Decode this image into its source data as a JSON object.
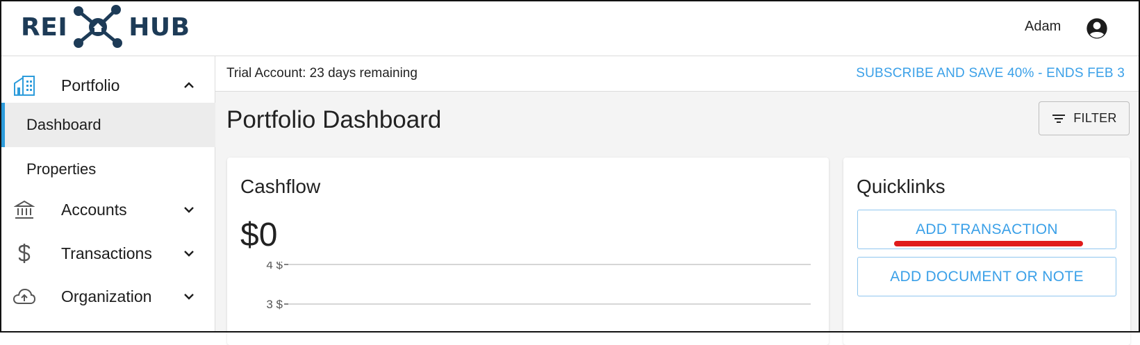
{
  "header": {
    "logo_left": "REI",
    "logo_right": "HUB",
    "user_name": "Adam",
    "account_icon": "account-circle-icon"
  },
  "sidebar": {
    "portfolio": {
      "label": "Portfolio",
      "icon": "building-icon",
      "expanded": true
    },
    "sub_items": [
      {
        "label": "Dashboard",
        "active": true
      },
      {
        "label": "Properties",
        "active": false
      }
    ],
    "items": [
      {
        "label": "Accounts",
        "icon": "bank-icon"
      },
      {
        "label": "Transactions",
        "icon": "dollar-icon"
      },
      {
        "label": "Organization",
        "icon": "cloud-upload-icon"
      }
    ]
  },
  "trial": {
    "text": "Trial Account: 23 days remaining",
    "subscribe_label": "SUBSCRIBE AND SAVE 40% - ENDS FEB 3"
  },
  "main": {
    "title": "Portfolio Dashboard",
    "filter_label": "FILTER"
  },
  "cashflow": {
    "title": "Cashflow",
    "value": "$0"
  },
  "quicklinks": {
    "title": "Quicklinks",
    "add_transaction_label": "ADD TRANSACTION",
    "add_document_label": "ADD DOCUMENT OR NOTE"
  },
  "chart_data": {
    "type": "bar",
    "categories": [],
    "values": [],
    "y_ticks": [
      "4 $",
      "3 $"
    ],
    "y_tick_values": [
      4,
      3
    ]
  },
  "colors": {
    "accent": "#3aa0e8",
    "brand": "#1d3b57",
    "highlight": "#e01b1b"
  }
}
